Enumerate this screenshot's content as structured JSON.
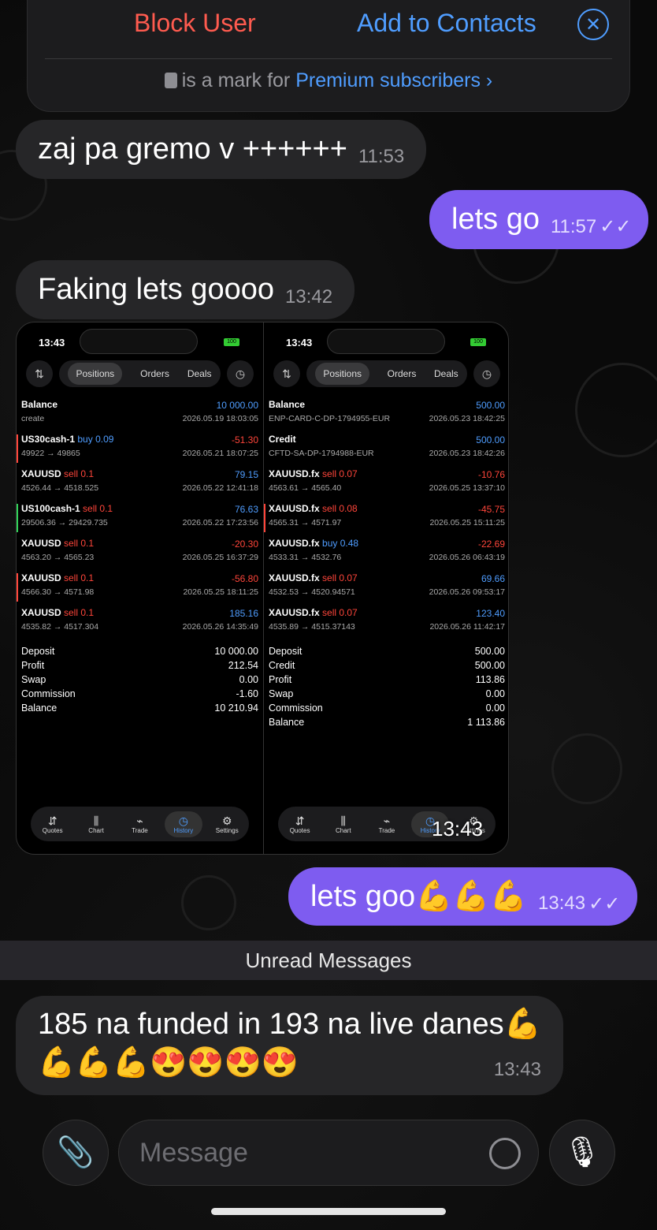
{
  "top_bar": {
    "block_label": "Block User",
    "add_label": "Add to Contacts",
    "close_icon": "✕",
    "note_prefix": "is a mark for",
    "note_link": "Premium subscribers ›"
  },
  "messages": [
    {
      "text": "zaj pa gremo v ++++++",
      "time": "11:53",
      "dir": "in"
    },
    {
      "text": "lets go",
      "time": "11:57",
      "dir": "out",
      "read": "✓✓"
    },
    {
      "text": "Faking lets goooo",
      "time": "13:42",
      "dir": "in"
    },
    {
      "text": "lets goo💪💪💪",
      "time": "13:43",
      "dir": "out",
      "read": "✓✓"
    },
    {
      "text": "185 na funded in 193 na live danes💪",
      "text2": "💪💪💪😍😍😍😍",
      "time": "13:43",
      "dir": "in"
    }
  ],
  "image_time": "13:43",
  "unread_label": "Unread Messages",
  "composer": {
    "placeholder": "Message",
    "attach_icon": "paperclip-icon",
    "mic_icon": "microphone-icon",
    "sticker_icon": "sticker-icon"
  },
  "screenshot": {
    "left": {
      "clock": "13:43",
      "battery": "100",
      "tabs": [
        "Positions",
        "Orders",
        "Deals"
      ],
      "rows": [
        {
          "name": "Balance",
          "side": "",
          "sub": "create",
          "value": "10 000.00",
          "date": "2026.05.19 18:03:05",
          "color": "#4f9dff",
          "bar": ""
        },
        {
          "name": "US30cash-1",
          "side": " buy 0.09",
          "sub": "49922 → 49865",
          "value": "-51.30",
          "date": "2026.05.21 18:07:25",
          "color": "#ff453a",
          "bar": "#ff453a",
          "sidecolor": "#4f9dff"
        },
        {
          "name": "XAUUSD",
          "side": " sell 0.1",
          "sub": "4526.44 → 4518.525",
          "value": "79.15",
          "date": "2026.05.22 12:41:18",
          "color": "#4f9dff",
          "bar": "",
          "sidecolor": "#ff453a"
        },
        {
          "name": "US100cash-1",
          "side": " sell 0.1",
          "sub": "29506.36 → 29429.735",
          "value": "76.63",
          "date": "2026.05.22 17:23:56",
          "color": "#4f9dff",
          "bar": "#30d158",
          "sidecolor": "#ff453a"
        },
        {
          "name": "XAUUSD",
          "side": " sell 0.1",
          "sub": "4563.20 → 4565.23",
          "value": "-20.30",
          "date": "2026.05.25 16:37:29",
          "color": "#ff453a",
          "bar": "",
          "sidecolor": "#ff453a"
        },
        {
          "name": "XAUUSD",
          "side": " sell 0.1",
          "sub": "4566.30 → 4571.98",
          "value": "-56.80",
          "date": "2026.05.25 18:11:25",
          "color": "#ff453a",
          "bar": "#ff453a",
          "sidecolor": "#ff453a"
        },
        {
          "name": "XAUUSD",
          "side": " sell 0.1",
          "sub": "4535.82 → 4517.304",
          "value": "185.16",
          "date": "2026.05.26 14:35:49",
          "color": "#4f9dff",
          "bar": "",
          "sidecolor": "#ff453a"
        }
      ],
      "summary": [
        {
          "label": "Deposit",
          "value": "10 000.00"
        },
        {
          "label": "Profit",
          "value": "212.54"
        },
        {
          "label": "Swap",
          "value": "0.00"
        },
        {
          "label": "Commission",
          "value": "-1.60"
        },
        {
          "label": "Balance",
          "value": "10 210.94"
        }
      ]
    },
    "right": {
      "clock": "13:43",
      "battery": "100",
      "tabs": [
        "Positions",
        "Orders",
        "Deals"
      ],
      "rows": [
        {
          "name": "Balance",
          "side": "",
          "sub": "ENP-CARD-C-DP-1794955-EUR",
          "value": "500.00",
          "date": "2026.05.23 18:42:25",
          "color": "#4f9dff",
          "bar": ""
        },
        {
          "name": "Credit",
          "side": "",
          "sub": "CFTD-SA-DP-1794988-EUR",
          "value": "500.00",
          "date": "2026.05.23 18:42:26",
          "color": "#4f9dff",
          "bar": ""
        },
        {
          "name": "XAUUSD.fx",
          "side": " sell 0.07",
          "sub": "4563.61 → 4565.40",
          "value": "-10.76",
          "date": "2026.05.25 13:37:10",
          "color": "#ff453a",
          "bar": "",
          "sidecolor": "#ff453a"
        },
        {
          "name": "XAUUSD.fx",
          "side": " sell 0.08",
          "sub": "4565.31 → 4571.97",
          "value": "-45.75",
          "date": "2026.05.25 15:11:25",
          "color": "#ff453a",
          "bar": "#ff453a",
          "sidecolor": "#ff453a"
        },
        {
          "name": "XAUUSD.fx",
          "side": " buy 0.48",
          "sub": "4533.31 → 4532.76",
          "value": "-22.69",
          "date": "2026.05.26 06:43:19",
          "color": "#ff453a",
          "bar": "",
          "sidecolor": "#4f9dff"
        },
        {
          "name": "XAUUSD.fx",
          "side": " sell 0.07",
          "sub": "4532.53 → 4520.94571",
          "value": "69.66",
          "date": "2026.05.26 09:53:17",
          "color": "#4f9dff",
          "bar": "",
          "sidecolor": "#ff453a"
        },
        {
          "name": "XAUUSD.fx",
          "side": " sell 0.07",
          "sub": "4535.89 → 4515.37143",
          "value": "123.40",
          "date": "2026.05.26 11:42:17",
          "color": "#4f9dff",
          "bar": "",
          "sidecolor": "#ff453a"
        }
      ],
      "summary": [
        {
          "label": "Deposit",
          "value": "500.00"
        },
        {
          "label": "Credit",
          "value": "500.00"
        },
        {
          "label": "Profit",
          "value": "113.86"
        },
        {
          "label": "Swap",
          "value": "0.00"
        },
        {
          "label": "Commission",
          "value": "0.00"
        },
        {
          "label": "Balance",
          "value": "1 113.86"
        }
      ]
    },
    "nav": [
      {
        "label": "Quotes",
        "icon": "⇵",
        "active": false
      },
      {
        "label": "Chart",
        "icon": "⫼",
        "active": false
      },
      {
        "label": "Trade",
        "icon": "⌁",
        "active": false
      },
      {
        "label": "History",
        "icon": "◷",
        "active": true
      },
      {
        "label": "Settings",
        "icon": "⚙",
        "active": false
      }
    ]
  }
}
